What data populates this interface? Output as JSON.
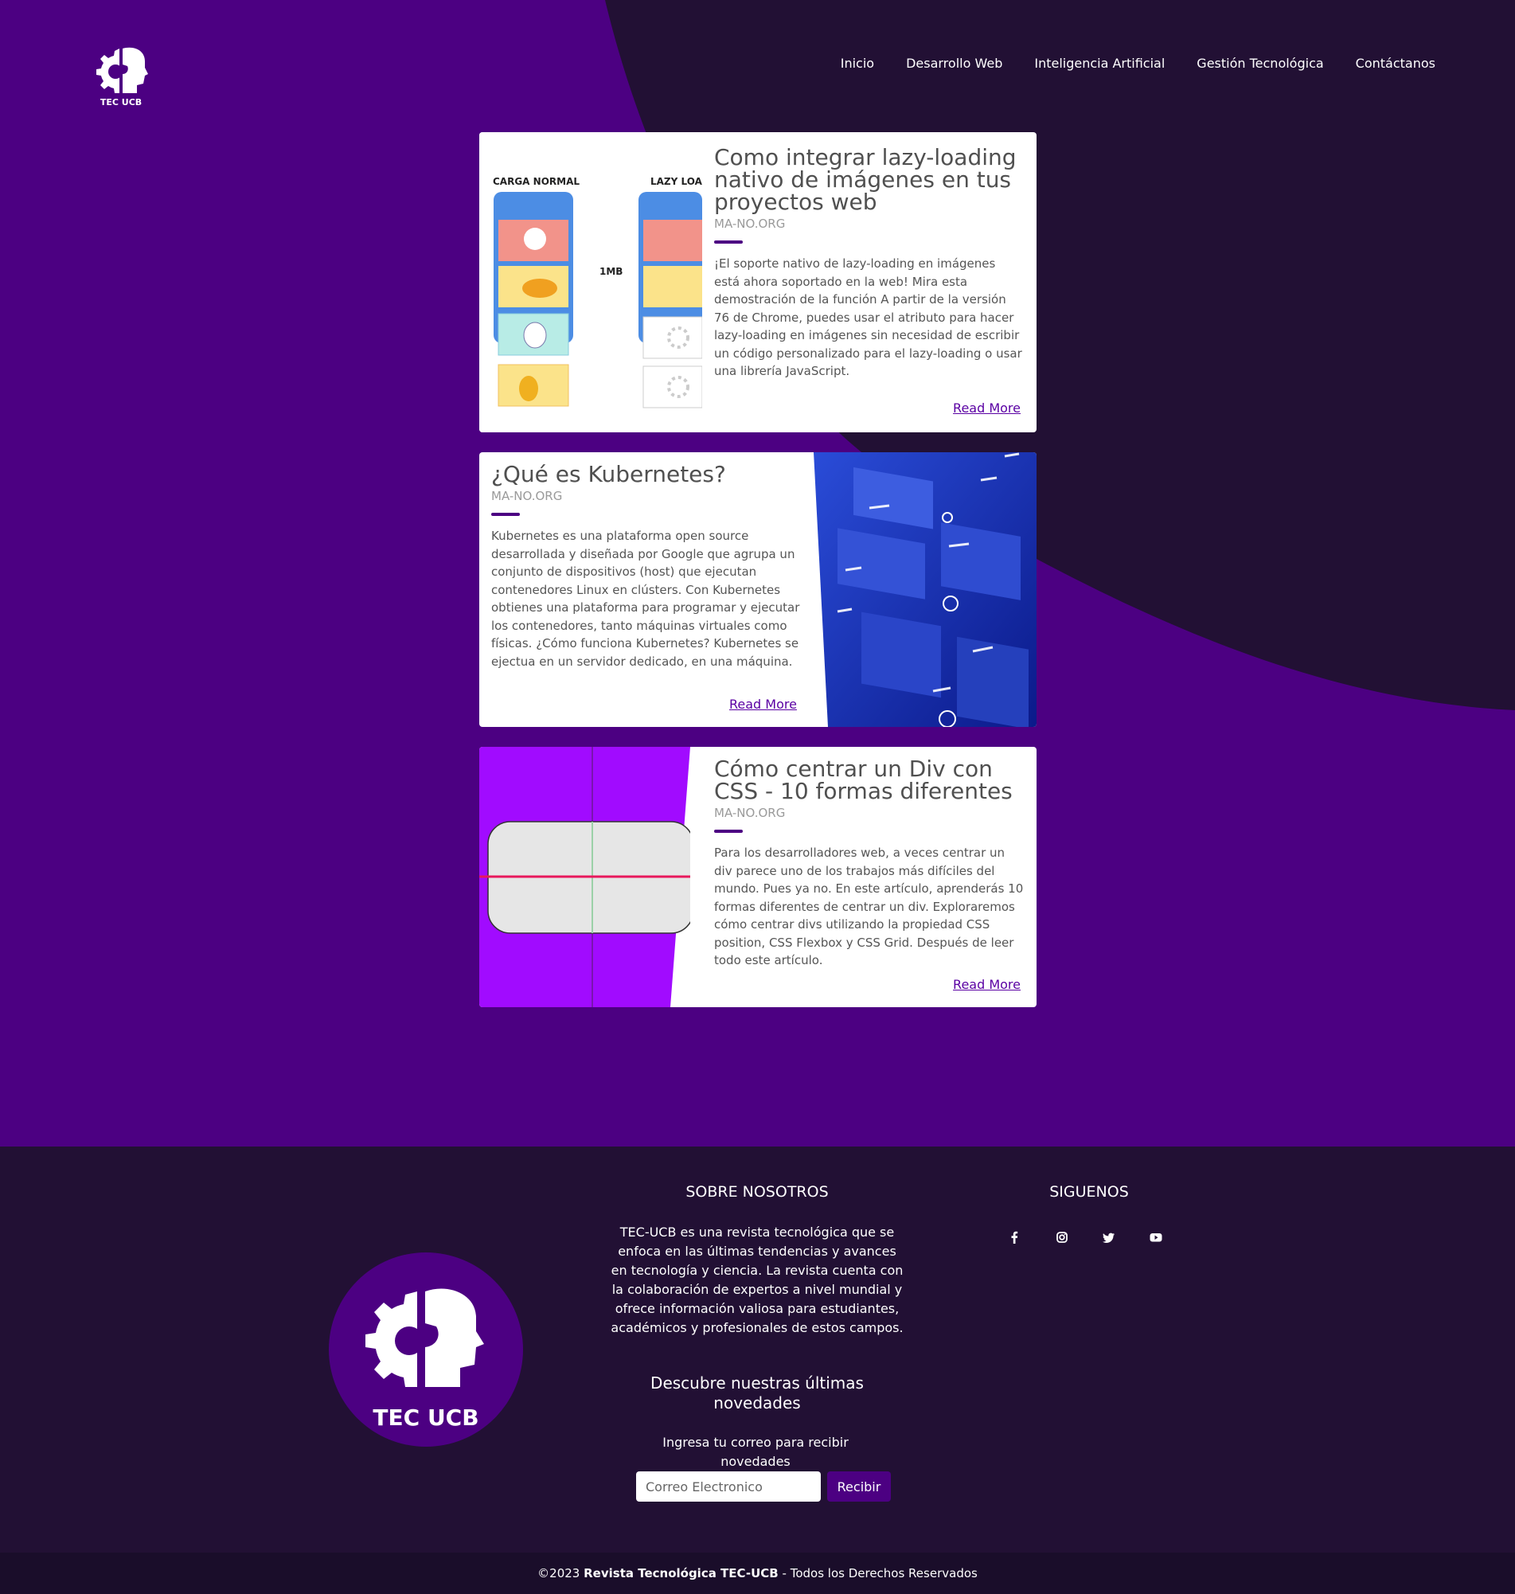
{
  "nav": {
    "logo_text": "TEC UCB",
    "items": [
      "Inicio",
      "Desarrollo Web",
      "Inteligencia Artificial",
      "Gestión Tecnológica",
      "Contáctanos"
    ]
  },
  "articles": [
    {
      "title": "Como integrar lazy-loading nativo de imágenes en tus proyectos web",
      "source": "MA-NO.ORG",
      "excerpt": "¡El soporte nativo de lazy-loading en imágenes está ahora soportado en la web! Mira esta demostración de la función A partir de la versión 76 de Chrome, puedes usar el atributo para hacer lazy-loading en imágenes sin necesidad de escribir un código personalizado para el lazy-loading o usar una librería JavaScript.",
      "read_more": "Read More",
      "image": {
        "label_left": "CARGA NORMAL",
        "label_right": "LAZY LOA",
        "size_label": "1MB"
      }
    },
    {
      "title": "¿Qué es Kubernetes?",
      "source": "MA-NO.ORG",
      "excerpt": "Kubernetes es una plataforma open source desarrollada y diseñada por Google que agrupa un conjunto de dispositivos (host) que ejecutan contenedores Linux en clústers. Con Kubernetes obtienes una plataforma para programar y ejecutar los contenedores, tanto máquinas virtuales como físicas. ¿Cómo funciona Kubernetes? Kubernetes se ejectua en un servidor dedicado, en una máquina.",
      "read_more": "Read More"
    },
    {
      "title": "Cómo centrar un Div con CSS - 10 formas diferentes",
      "source": "MA-NO.ORG",
      "excerpt": "Para los desarrolladores web, a veces centrar un div parece uno de los trabajos más difíciles del mundo. Pues ya no. En este artículo, aprenderás 10 formas diferentes de centrar un div. Exploraremos cómo centrar divs utilizando la propiedad CSS position, CSS Flexbox y CSS Grid. Después de leer todo este artículo.",
      "read_more": "Read More"
    }
  ],
  "footer": {
    "about_title": "SOBRE NOSOTROS",
    "about_text": "TEC-UCB es una revista tecnológica que se enfoca en las últimas tendencias y avances en tecnología y ciencia. La revista cuenta con la colaboración de expertos a nivel mundial y ofrece información valiosa para estudiantes, académicos y profesionales de estos campos.",
    "newsletter_title": "Descubre nuestras últimas novedades",
    "newsletter_text": "Ingresa tu correo para recibir novedades",
    "email_placeholder": "Correo Electronico",
    "submit_label": "Recibir",
    "follow_title": "SIGUENOS",
    "logo_text": "TEC UCB",
    "social": [
      "facebook-icon",
      "instagram-icon",
      "twitter-icon",
      "youtube-icon"
    ]
  },
  "copyright": {
    "prefix": "©2023 ",
    "brand": "Revista Tecnológica TEC-UCB",
    "suffix": " - Todos los Derechos Reservados"
  },
  "colors": {
    "primary": "#4c0082",
    "dark": "#221034",
    "link": "#5a00a3"
  }
}
